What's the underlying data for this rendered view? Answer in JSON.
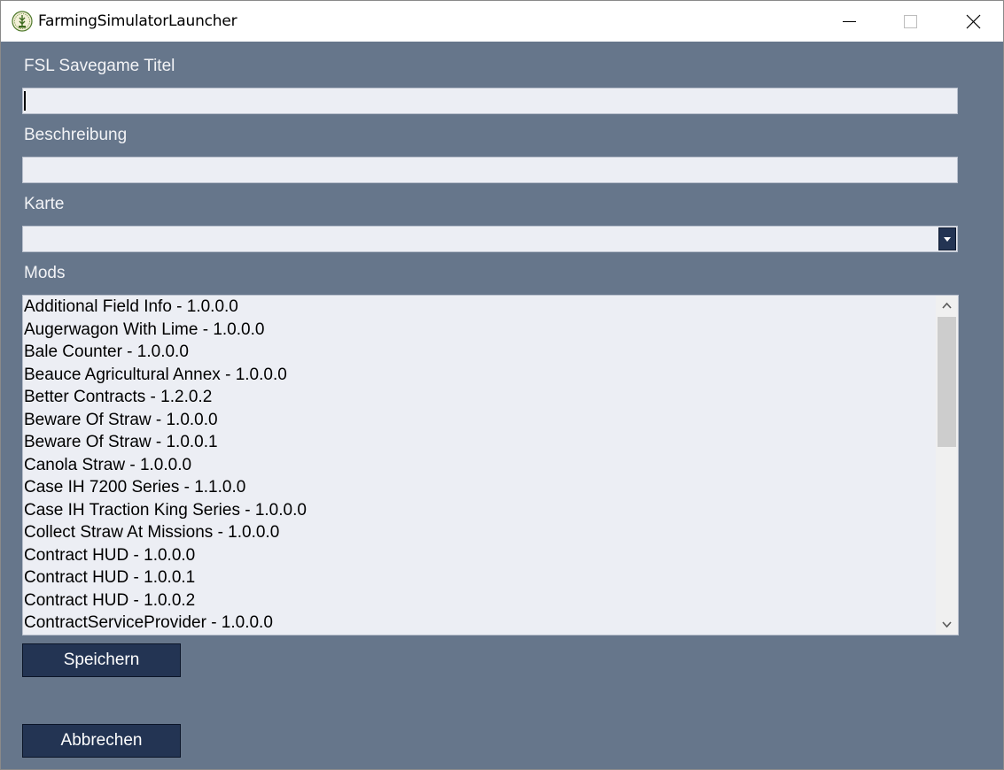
{
  "window": {
    "title": "FarmingSimulatorLauncher",
    "app_icon": "fsl-logo-icon",
    "controls": {
      "minimize": "minimize-icon",
      "maximize": "maximize-icon",
      "close": "close-icon"
    }
  },
  "form": {
    "title_label": "FSL Savegame Titel",
    "title_value": "",
    "description_label": "Beschreibung",
    "description_value": "",
    "map_label": "Karte",
    "map_value": "",
    "mods_label": "Mods",
    "mods": [
      "Additional Field Info - 1.0.0.0",
      "Augerwagon With Lime - 1.0.0.0",
      "Bale Counter - 1.0.0.0",
      "Beauce Agricultural Annex - 1.0.0.0",
      "Better Contracts - 1.2.0.2",
      "Beware Of Straw - 1.0.0.0",
      "Beware Of Straw - 1.0.0.1",
      "Canola Straw - 1.0.0.0",
      "Case IH 7200 Series - 1.1.0.0",
      "Case IH Traction King Series - 1.0.0.0",
      "Collect Straw At Missions - 1.0.0.0",
      "Contract HUD - 1.0.0.0",
      "Contract HUD - 1.0.0.1",
      "Contract HUD - 1.0.0.2",
      "ContractServiceProvider - 1.0.0.0"
    ],
    "save_label": "Speichern",
    "cancel_label": "Abbrechen"
  },
  "colors": {
    "background": "#66768b",
    "button": "#233453",
    "input": "#eceef4",
    "label": "#f2f3f6"
  }
}
